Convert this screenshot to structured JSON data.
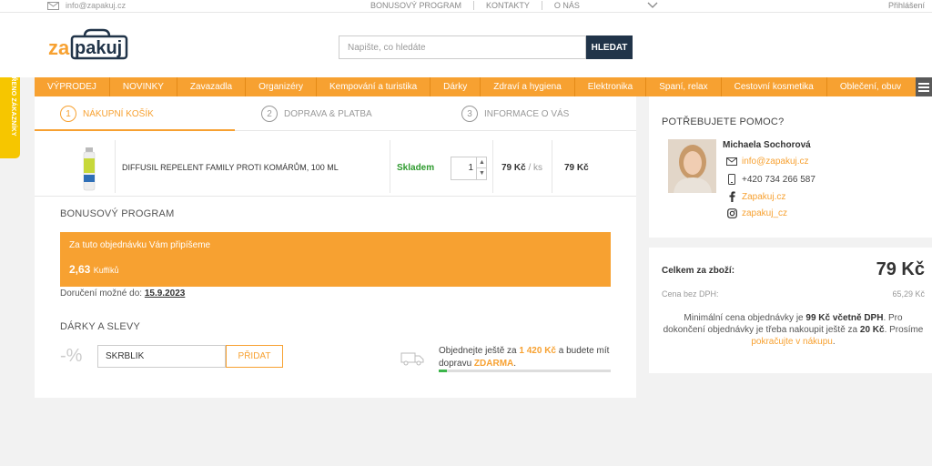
{
  "topbar": {
    "email": "info@zapakuj.cz",
    "links": [
      "BONUSOVÝ PROGRAM",
      "KONTAKTY",
      "O NÁS"
    ],
    "login": "Přihlášení"
  },
  "header": {
    "logo_text": "zapakuj",
    "search_placeholder": "Napište, co hledáte",
    "search_button": "HLEDAT"
  },
  "nav": {
    "items": [
      "VÝPRODEJ",
      "NOVINKY",
      "Zavazadla",
      "Organizéry",
      "Kempování a turistika",
      "Dárky",
      "Zdraví a hygiena",
      "Elektronika",
      "Spaní, relax",
      "Cestovní kosmetika",
      "Oblečení, obuv"
    ]
  },
  "side_badge": {
    "text": "OVĚŘENO ZÁKAZNÍKY"
  },
  "steps": [
    {
      "num": "1",
      "label": "NÁKUPNÍ KOŠÍK"
    },
    {
      "num": "2",
      "label": "DOPRAVA & PLATBA"
    },
    {
      "num": "3",
      "label": "INFORMACE O VÁS"
    }
  ],
  "cart": {
    "product_name": "DIFFUSIL REPELENT FAMILY PROTI KOMÁRŮM, 100 ML",
    "stock": "Skladem",
    "quantity": "1",
    "unit_price": "79 Kč",
    "unit_suffix": "/ ks",
    "total": "79 Kč"
  },
  "bonus": {
    "title": "BONUSOVÝ PROGRAM",
    "line1": "Za tuto objednávku Vám připíšeme",
    "amount": "2,63",
    "unit": "Kuffíků",
    "delivery_label": "Doručení možné do:",
    "delivery_date": "15.9.2023"
  },
  "gifts": {
    "title": "DÁRKY A SLEVY",
    "percent_symbol": "-%",
    "coupon_value": "SKRBLIK",
    "add_button": "PŘIDAT",
    "ship_pre": "Objednejte ještě za",
    "ship_amount": "1 420 Kč",
    "ship_mid": "a budete mít dopravu",
    "ship_free": "ZDARMA",
    "ship_end": ".",
    "progress": 0.05
  },
  "help": {
    "title": "POTŘEBUJETE POMOC?",
    "name": "Michaela Sochorová",
    "email": "info@zapakuj.cz",
    "phone": "+420 734 266 587",
    "facebook": "Zapakuj.cz",
    "instagram": "zapakuj_cz"
  },
  "summary": {
    "total_label": "Celkem za zboží:",
    "total_value": "79 Kč",
    "net_label": "Cena bez DPH:",
    "net_value": "65,29 Kč",
    "note_1": "Minimální cena objednávky je",
    "note_min": "99 Kč včetně DPH",
    "note_2": ". Pro dokončení objednávky je třeba nakoupit ještě za",
    "note_rest": "20 Kč",
    "note_3": ". Prosíme",
    "note_link": "pokračujte v nákupu",
    "note_4": "."
  },
  "colors": {
    "accent": "#f7a131",
    "dark_button": "#213449",
    "stock_green": "#2d9a2d",
    "badge_yellow": "#f6c600"
  }
}
